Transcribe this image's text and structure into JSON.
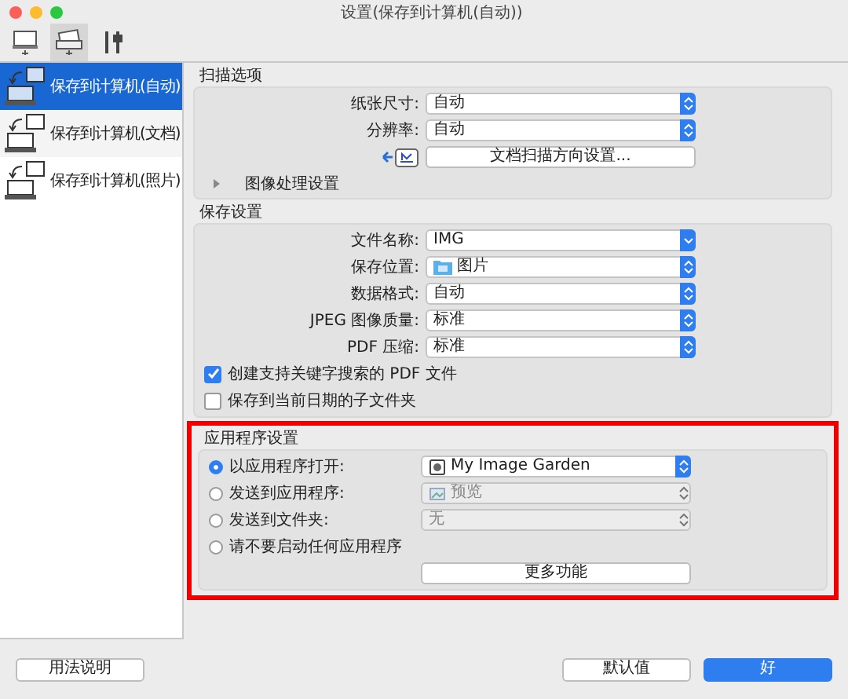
{
  "window": {
    "title": "设置(保存到计算机(自动))"
  },
  "toolbar": [
    {
      "kind": "computer",
      "selected": false
    },
    {
      "kind": "scanner",
      "selected": true
    },
    {
      "kind": "tools",
      "selected": false
    }
  ],
  "sidebar": {
    "items": [
      {
        "label": "保存到计算机(自动)",
        "selected": true
      },
      {
        "label": "保存到计算机(文档)",
        "selected": false
      },
      {
        "label": "保存到计算机(照片)",
        "selected": false
      }
    ]
  },
  "scan_options": {
    "title": "扫描选项",
    "fields": [
      {
        "label": "纸张尺寸:",
        "value": "自动"
      },
      {
        "label": "分辨率:",
        "value": "自动"
      }
    ],
    "orientation_button": "文档扫描方向设置...",
    "image_processing": {
      "label": "图像处理设置",
      "expanded": false
    }
  },
  "save_settings": {
    "title": "保存设置",
    "fields": [
      {
        "label": "文件名称:",
        "value": "IMG",
        "kind": "combo"
      },
      {
        "label": "保存位置:",
        "value": "图片",
        "kind": "folder"
      },
      {
        "label": "数据格式:",
        "value": "自动",
        "kind": "plain"
      },
      {
        "label": "JPEG 图像质量:",
        "value": "标准",
        "kind": "plain"
      },
      {
        "label": "PDF 压缩:",
        "value": "标准",
        "kind": "plain"
      }
    ],
    "checkboxes": [
      {
        "label": "创建支持关键字搜索的 PDF 文件",
        "checked": true
      },
      {
        "label": "保存到当前日期的子文件夹",
        "checked": false
      }
    ]
  },
  "app_settings": {
    "title": "应用程序设置",
    "highlighted": true,
    "options": [
      {
        "label": "以应用程序打开:",
        "selected": true,
        "dropdown": {
          "value": "My Image Garden",
          "kind": "app",
          "disabled": false
        }
      },
      {
        "label": "发送到应用程序:",
        "selected": false,
        "dropdown": {
          "value": "预览",
          "kind": "preview",
          "disabled": true
        }
      },
      {
        "label": "发送到文件夹:",
        "selected": false,
        "dropdown": {
          "value": "无",
          "kind": "plain",
          "disabled": true
        }
      },
      {
        "label": "请不要启动任何应用程序",
        "selected": false
      }
    ],
    "more_button": "更多功能"
  },
  "footer": {
    "help_button": "用法说明",
    "default_button": "默认值",
    "ok_button": "好"
  }
}
